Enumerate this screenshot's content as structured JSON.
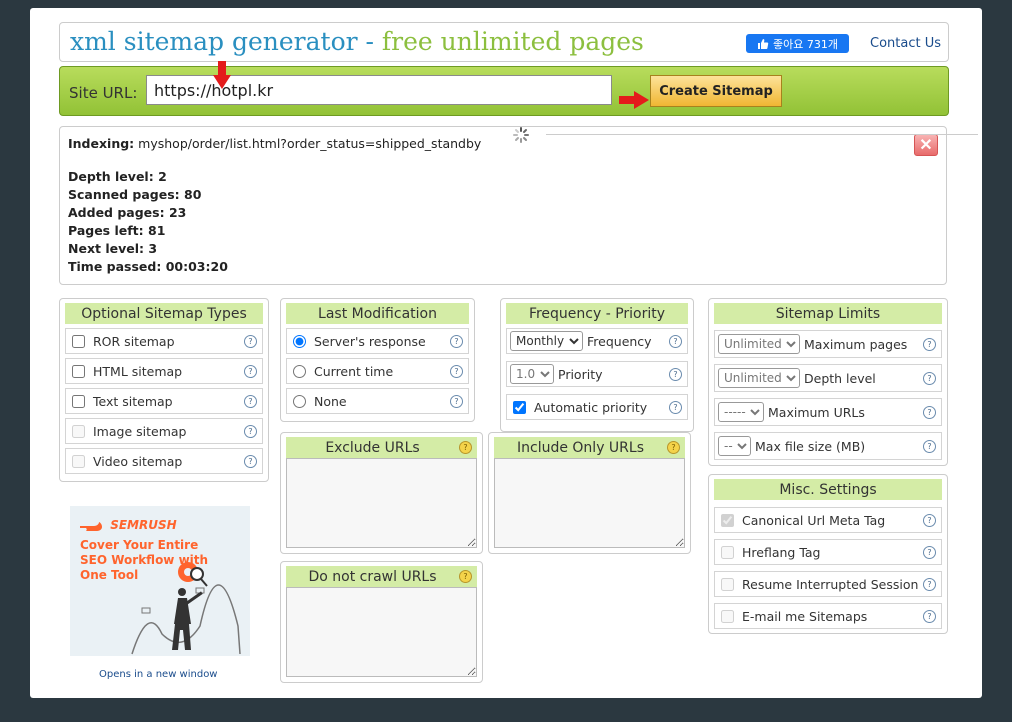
{
  "header": {
    "title_part1": "xml sitemap generator -",
    "title_part2": "free unlimited pages",
    "fb_like_label": "좋아요 731개",
    "contact_link": "Contact Us"
  },
  "url_bar": {
    "label": "Site URL:",
    "value": "https://hotpl.kr",
    "create_button": "Create Sitemap"
  },
  "status": {
    "indexing_label": "Indexing:",
    "indexing_path": "myshop/order/list.html?order_status=shipped_standby",
    "stats": [
      {
        "label": "Depth level:",
        "value": "2"
      },
      {
        "label": "Scanned pages:",
        "value": "80"
      },
      {
        "label": "Added pages:",
        "value": "23"
      },
      {
        "label": "Pages left:",
        "value": "81"
      },
      {
        "label": "Next level:",
        "value": "3"
      },
      {
        "label": "Time passed:",
        "value": "00:03:20"
      }
    ],
    "close_symbol": "✕"
  },
  "help_symbol": "?",
  "optional_types": {
    "title": "Optional Sitemap Types",
    "items": [
      {
        "label": "ROR sitemap",
        "checked": false,
        "disabled": false
      },
      {
        "label": "HTML sitemap",
        "checked": false,
        "disabled": false
      },
      {
        "label": "Text sitemap",
        "checked": false,
        "disabled": false
      },
      {
        "label": "Image sitemap",
        "checked": false,
        "disabled": true
      },
      {
        "label": "Video sitemap",
        "checked": false,
        "disabled": true
      }
    ]
  },
  "last_modification": {
    "title": "Last Modification",
    "options": [
      {
        "label": "Server's response",
        "selected": true
      },
      {
        "label": "Current time",
        "selected": false
      },
      {
        "label": "None",
        "selected": false
      }
    ]
  },
  "frequency_priority": {
    "title": "Frequency - Priority",
    "frequency_value": "Monthly",
    "frequency_label": "Frequency",
    "priority_value": "1.0",
    "priority_label": "Priority",
    "automatic_priority_label": "Automatic priority",
    "automatic_priority_checked": true
  },
  "sitemap_limits": {
    "title": "Sitemap Limits",
    "rows": [
      {
        "value": "Unlimited",
        "label": "Maximum pages"
      },
      {
        "value": "Unlimited",
        "label": "Depth level"
      },
      {
        "value": "-----",
        "label": "Maximum URLs"
      },
      {
        "value": "--",
        "label": "Max file size (MB)"
      }
    ]
  },
  "exclude_urls": {
    "title": "Exclude URLs"
  },
  "include_only_urls": {
    "title": "Include Only URLs"
  },
  "do_not_crawl_urls": {
    "title": "Do not crawl URLs"
  },
  "misc_settings": {
    "title": "Misc. Settings",
    "items": [
      {
        "label": "Canonical Url Meta Tag",
        "checked": true,
        "disabled": true
      },
      {
        "label": "Hreflang Tag",
        "checked": false,
        "disabled": true
      },
      {
        "label": "Resume Interrupted Session",
        "checked": false,
        "disabled": true
      },
      {
        "label": "E-mail me Sitemaps",
        "checked": false,
        "disabled": true
      }
    ]
  },
  "ad": {
    "logo_text": "SEMRUSH",
    "headline": "Cover Your Entire SEO Workflow with One Tool",
    "link_text": "Opens in a new window"
  },
  "colors": {
    "accent_green": "#8cbf3f",
    "title_blue": "#2a8fc0",
    "panel_header": "#d4eca6",
    "button_gold": "#f0b632",
    "arrow_red": "#e41b1b"
  }
}
